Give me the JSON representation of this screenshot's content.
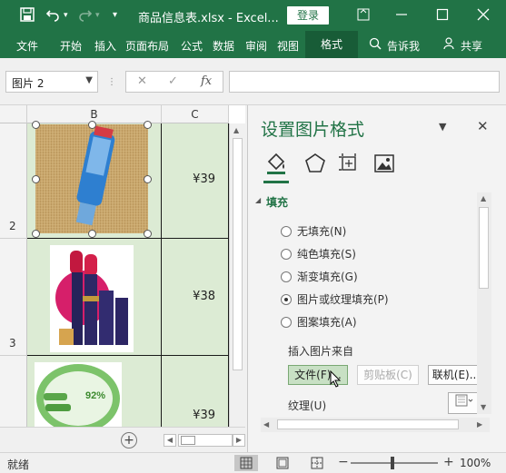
{
  "titlebar": {
    "filename": "商品信息表.xlsx",
    "app_suffix": "- Excel...",
    "login_label": "登录"
  },
  "ribbon": {
    "tabs": [
      "文件",
      "开始",
      "插入",
      "页面布局",
      "公式",
      "数据",
      "审阅",
      "视图"
    ],
    "active_tab": "格式",
    "tell_me": "告诉我",
    "share": "共享"
  },
  "formula_bar": {
    "name_box": "图片 2",
    "formula": ""
  },
  "sheet": {
    "columns": [
      "B",
      "C"
    ],
    "rows": [
      {
        "number": "2",
        "price": "¥39"
      },
      {
        "number": "3",
        "price": "¥38"
      },
      {
        "number": "",
        "price": "¥39"
      }
    ]
  },
  "pane": {
    "title": "设置图片格式",
    "section": "填充",
    "fill_options": [
      {
        "label": "无填充(N)",
        "selected": false
      },
      {
        "label": "纯色填充(S)",
        "selected": false
      },
      {
        "label": "渐变填充(G)",
        "selected": false
      },
      {
        "label": "图片或纹理填充(P)",
        "selected": true
      },
      {
        "label": "图案填充(A)",
        "selected": false
      }
    ],
    "insert_from": "插入图片来自",
    "file_btn": "文件(F)...",
    "clipboard_btn": "剪贴板(C)",
    "online_btn": "联机(E)...",
    "texture_label": "纹理(U)"
  },
  "status": {
    "text": "就绪",
    "zoom": "100%"
  },
  "colors": {
    "accent": "#217346",
    "cell_fill": "#dcebd4"
  }
}
